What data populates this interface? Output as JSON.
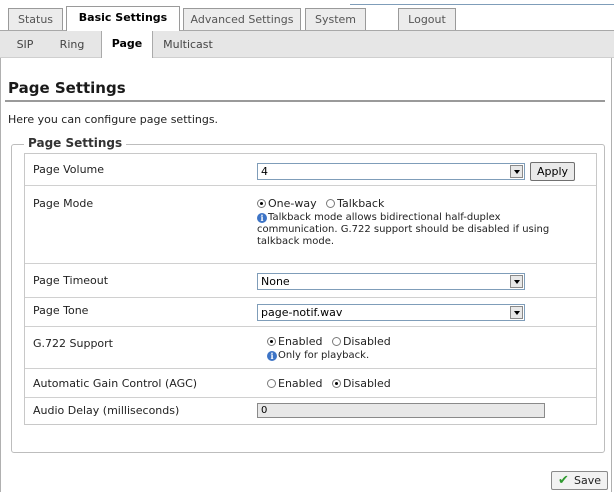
{
  "top_tabs": [
    {
      "label": "Status"
    },
    {
      "label": "Basic Settings"
    },
    {
      "label": "Advanced Settings"
    },
    {
      "label": "System"
    },
    {
      "label": "Logout"
    }
  ],
  "sub_tabs": [
    {
      "label": "SIP"
    },
    {
      "label": "Ring"
    },
    {
      "label": "Page"
    },
    {
      "label": "Multicast"
    }
  ],
  "page": {
    "title": "Page Settings",
    "intro": "Here you can configure page settings.",
    "section_legend": "Page Settings"
  },
  "fields": {
    "volume": {
      "label": "Page Volume",
      "value": "4",
      "apply_label": "Apply"
    },
    "mode": {
      "label": "Page Mode",
      "options": [
        "One-way",
        "Talkback"
      ],
      "selected": "One-way",
      "note": "Talkback mode allows bidirectional half-duplex communication. G.722 support should be disabled if using talkback mode."
    },
    "timeout": {
      "label": "Page Timeout",
      "value": "None"
    },
    "tone": {
      "label": "Page Tone",
      "value": "page-notif.wav"
    },
    "g722": {
      "label": "G.722 Support",
      "options": [
        "Enabled",
        "Disabled"
      ],
      "selected": "Enabled",
      "note": "Only for playback."
    },
    "agc": {
      "label": "Automatic Gain Control (AGC)",
      "options": [
        "Enabled",
        "Disabled"
      ],
      "selected": "Disabled"
    },
    "delay": {
      "label": "Audio Delay (milliseconds)",
      "value": "0"
    }
  },
  "footer": {
    "save_label": "Save"
  },
  "icons": {
    "info": "info-icon",
    "save": "checkmark-icon"
  },
  "colors": {
    "accent": "#3d74c6",
    "save_check": "#2f9a2f"
  }
}
